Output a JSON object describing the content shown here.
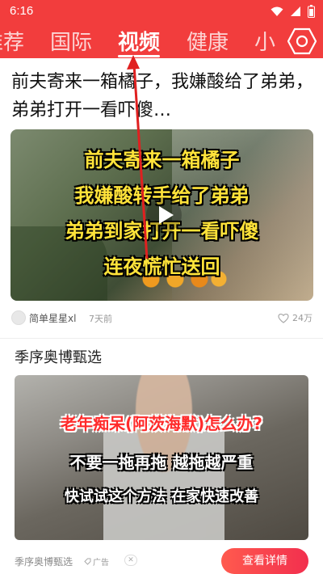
{
  "status_bar": {
    "time": "6:16"
  },
  "tabs": [
    {
      "label": "推荐"
    },
    {
      "label": "国际"
    },
    {
      "label": "视频"
    },
    {
      "label": "健康"
    },
    {
      "label": "小"
    }
  ],
  "active_tab": "视频",
  "feed": {
    "video_card": {
      "title": "前夫寄来一箱橘子，我嫌酸给了弟弟，弟弟打开一看吓傻…",
      "captions": [
        "前夫寄来一箱橘子",
        "我嫌酸转手给了弟弟",
        "弟弟到家打开一看吓傻",
        "连夜慌忙送回"
      ],
      "author": "简单星星xl",
      "published": "7天前",
      "likes": "24万"
    },
    "ad_card": {
      "title": "季序奥博甄选",
      "captions": [
        "老年痴呆(阿茨海默)怎么办?",
        "不要一拖再拖 越拖越严重",
        "快试试这个方法 在家快速改善"
      ],
      "source": "季序奥博甄选",
      "ad_label": "广告",
      "close_symbol": "✕",
      "cta_label": "查看详情"
    }
  },
  "colors": {
    "brand": "#f23d3d",
    "caption_yellow": "#ffe33a",
    "annotation_arrow": "#e02020"
  }
}
